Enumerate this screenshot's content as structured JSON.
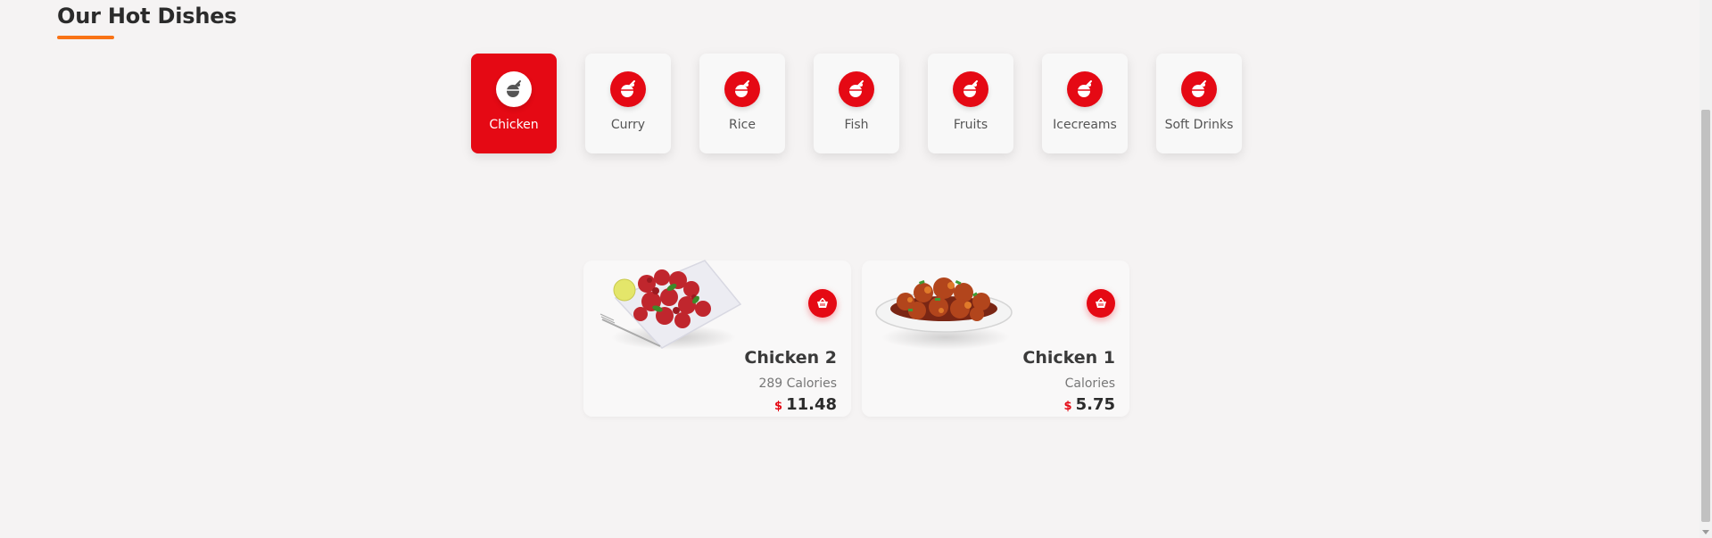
{
  "section": {
    "title": "Our Hot Dishes"
  },
  "colors": {
    "accent": "#e50914",
    "underline": "#f97316"
  },
  "categories": [
    {
      "label": "Chicken",
      "icon": "dish-icon",
      "active": true
    },
    {
      "label": "Curry",
      "icon": "dish-icon",
      "active": false
    },
    {
      "label": "Rice",
      "icon": "dish-icon",
      "active": false
    },
    {
      "label": "Fish",
      "icon": "dish-icon",
      "active": false
    },
    {
      "label": "Fruits",
      "icon": "dish-icon",
      "active": false
    },
    {
      "label": "Icecreams",
      "icon": "dish-icon",
      "active": false
    },
    {
      "label": "Soft Drinks",
      "icon": "dish-icon",
      "active": false
    }
  ],
  "dishes": [
    {
      "name": "Chicken 2",
      "calories": "289 Calories",
      "currency": "$",
      "price": "11.48",
      "image": "fried-chicken-image",
      "cart_icon": "basket-icon"
    },
    {
      "name": "Chicken 1",
      "calories": "Calories",
      "currency": "$",
      "price": "5.75",
      "image": "chicken-curry-image",
      "cart_icon": "basket-icon"
    }
  ]
}
